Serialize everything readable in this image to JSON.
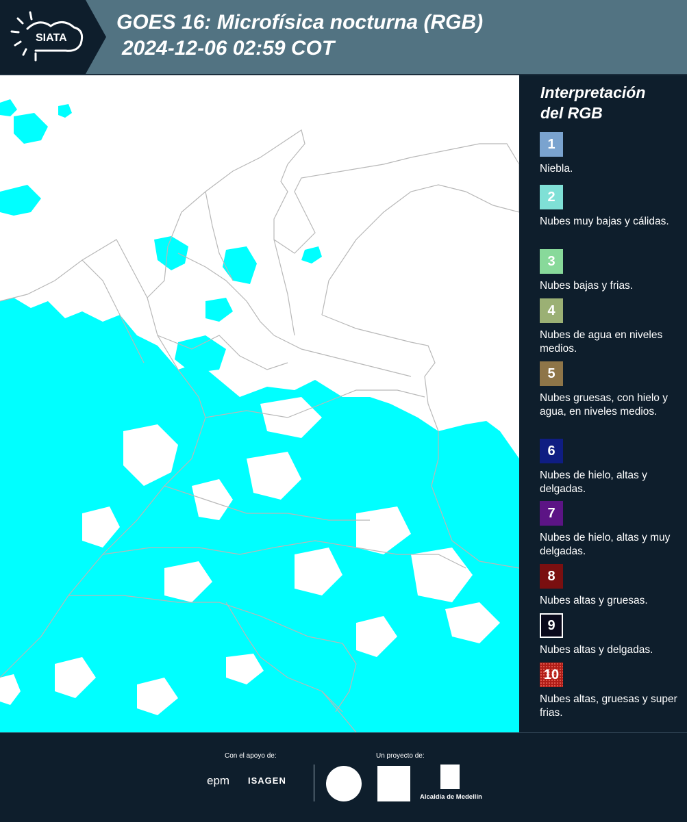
{
  "header": {
    "logo_text": "SIATA",
    "title_line1": "GOES 16: Microfísica nocturna (RGB)",
    "title_line2": "2024-12-06 02:59 COT"
  },
  "legend": {
    "title_line1": "Interpretación",
    "title_line2": "del RGB",
    "items": [
      {
        "number": "1",
        "label": "Niebla.",
        "color": "#7aa3cf"
      },
      {
        "number": "2",
        "label": "Nubes muy bajas y cálidas.",
        "color": "#7fe0d6"
      },
      {
        "number": "3",
        "label": "Nubes bajas y frias.",
        "color": "#88d99a"
      },
      {
        "number": "4",
        "label": "Nubes de agua en niveles medios.",
        "color": "#9bb074"
      },
      {
        "number": "5",
        "label": "Nubes gruesas, con hielo y agua, en niveles medios.",
        "color": "#8e7548"
      },
      {
        "number": "6",
        "label": "Nubes de hielo, altas y delgadas.",
        "color": "#0f1d82"
      },
      {
        "number": "7",
        "label": "Nubes de hielo, altas y muy delgadas.",
        "color": "#5c1485"
      },
      {
        "number": "8",
        "label": "Nubes altas y gruesas.",
        "color": "#7a0f10"
      },
      {
        "number": "9",
        "label": "Nubes altas y delgadas.",
        "color": "#0a0a1c"
      },
      {
        "number": "10",
        "label": "Nubes altas, gruesas y super frias.",
        "color": "#b01d17"
      }
    ]
  },
  "map": {
    "cloud_color": "#00ffff",
    "land_color": "#ffffff",
    "border_color": "#b8b8b8"
  },
  "footer": {
    "support_label": "Con el apoyo de:",
    "project_label": "Un proyecto de:",
    "epm": "epm",
    "isagen": "ISAGEN",
    "alcaldia": "Alcaldía de Medellín"
  }
}
